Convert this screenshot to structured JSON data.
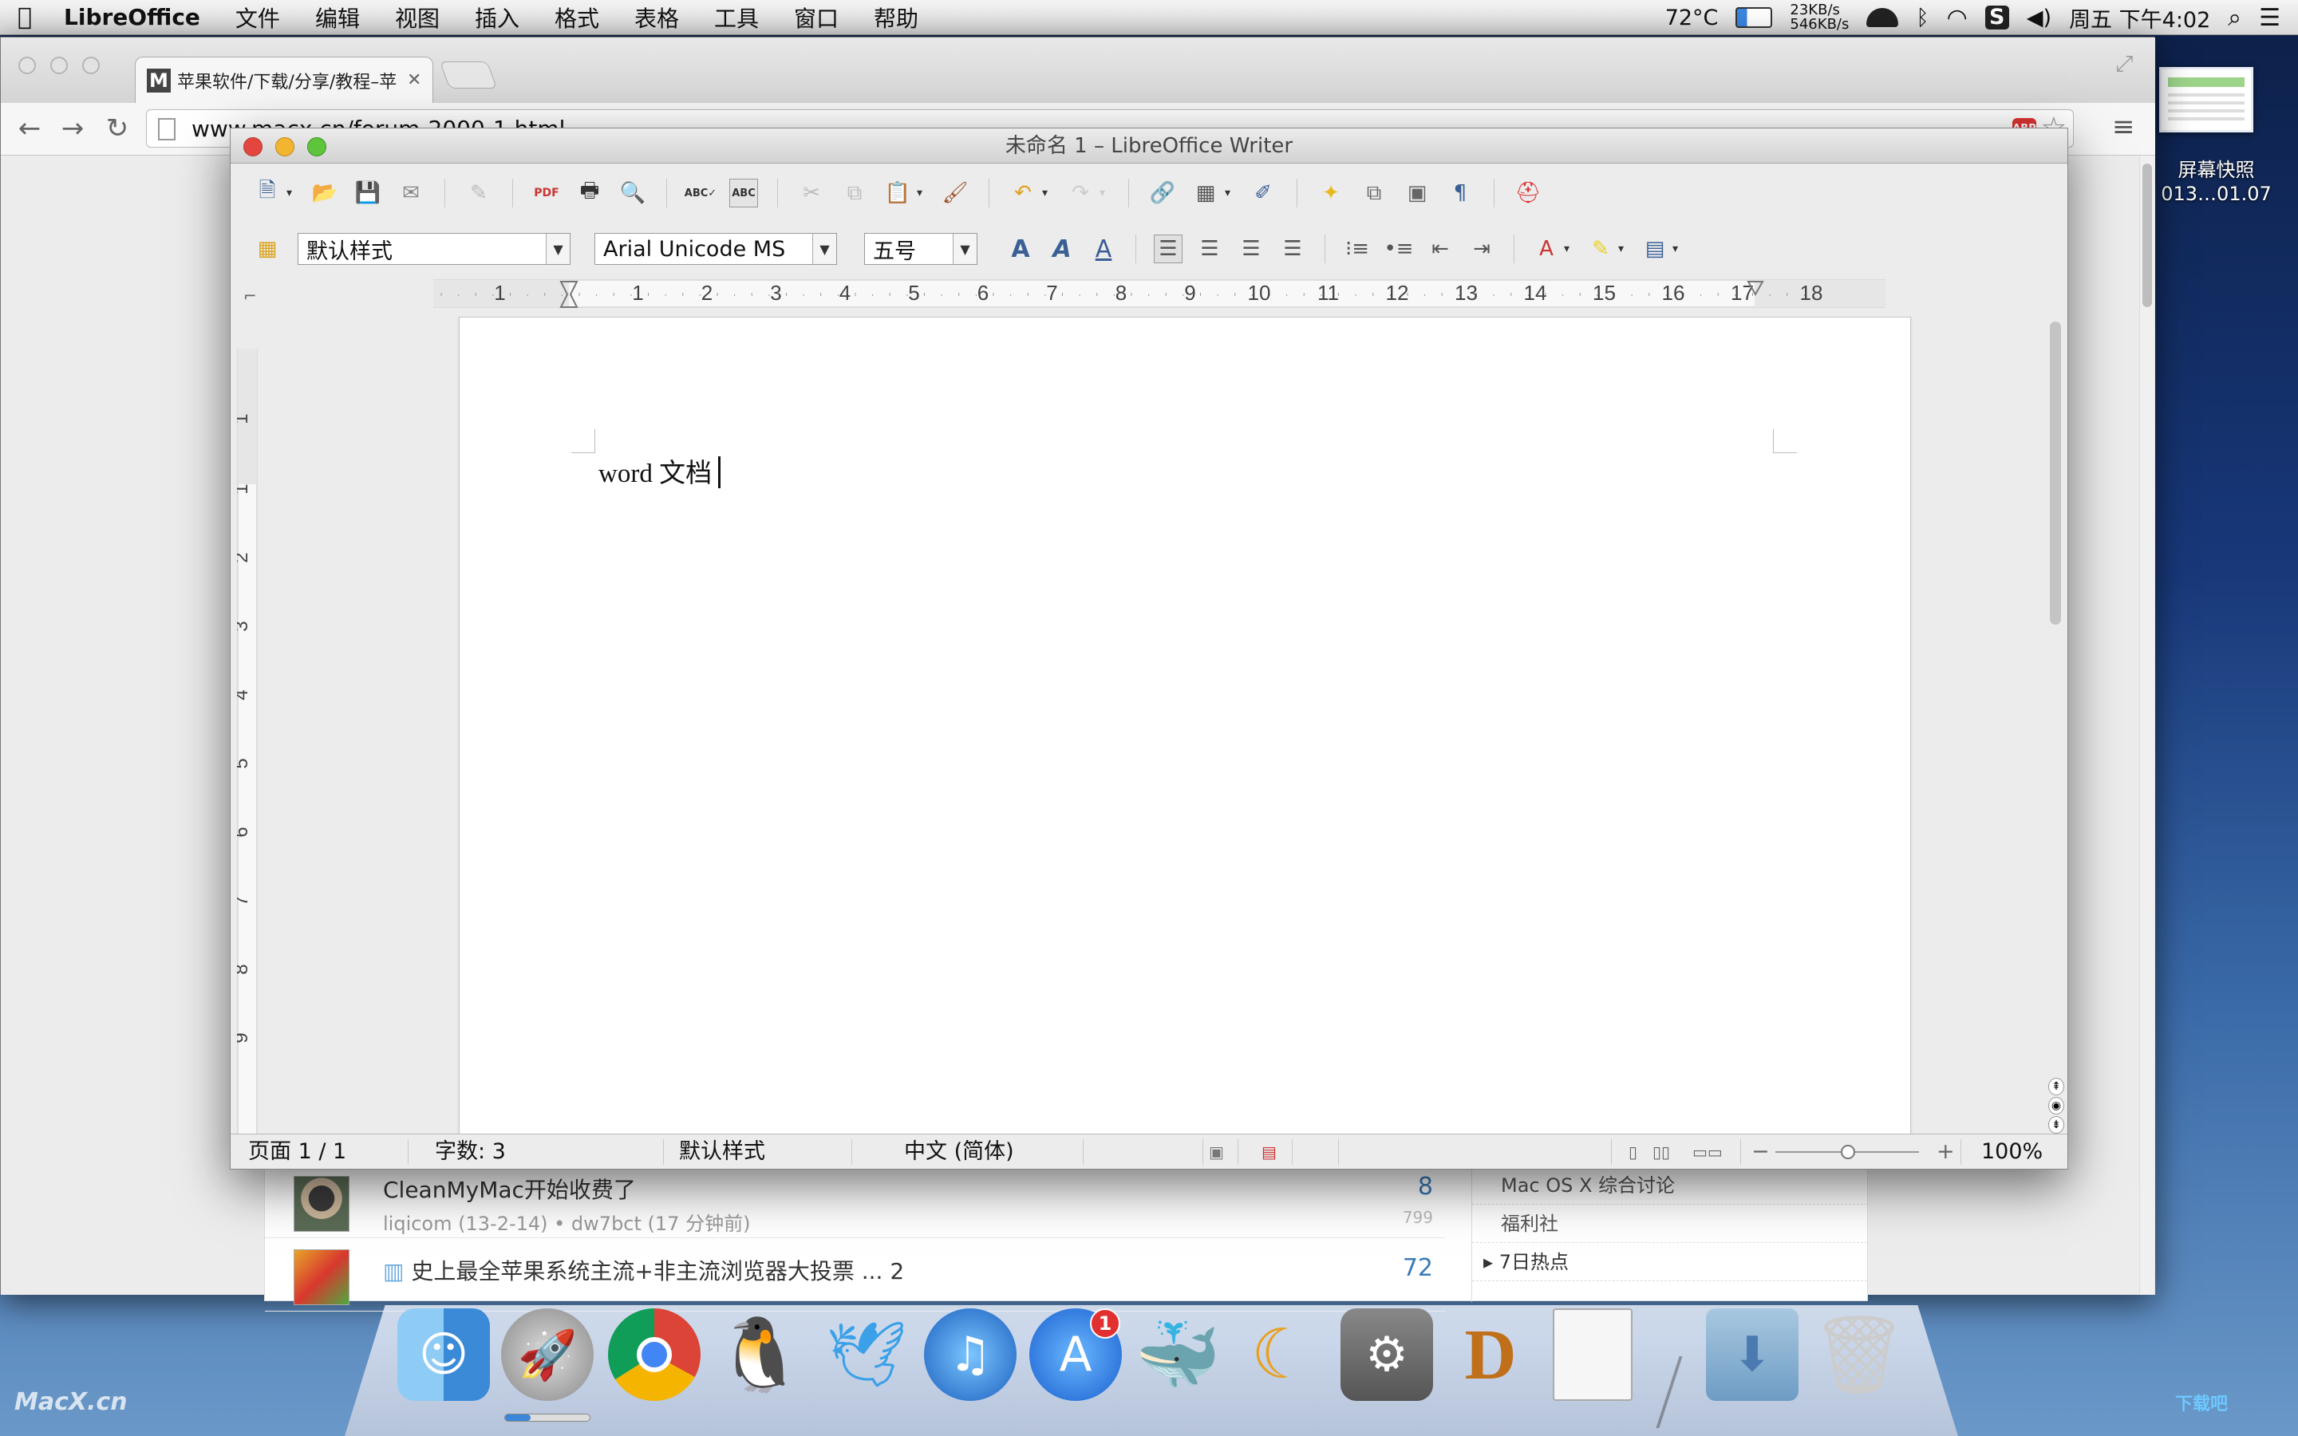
{
  "menubar": {
    "apple": "",
    "app_name": "LibreOffice",
    "items": [
      "文件",
      "编辑",
      "视图",
      "插入",
      "格式",
      "表格",
      "工具",
      "窗口",
      "帮助"
    ],
    "temp": "72°C",
    "net_up": "23KB/s",
    "net_down": "546KB/s",
    "clock": "周五 下午4:02"
  },
  "desktop": {
    "screenshot_label_line1": "屏幕快照",
    "screenshot_label_line2": "013…01.07"
  },
  "browser": {
    "tab_title": "苹果软件/下载/分享/教程–苹",
    "tab_favicon": "M",
    "url": "www.macx.cn/forum-2000-1.html",
    "abp": "ABP",
    "posts": [
      {
        "title": "CleanMyMac开始收费了",
        "meta": "liqicom (13-2-14) • dw7bct (17 分钟前)",
        "count": "8",
        "views": "799"
      },
      {
        "title": "史上最全苹果系统主流+非主流浏览器大投票 ... 2",
        "meta": "",
        "count": "72",
        "views": ""
      }
    ],
    "side_links": [
      "Mac OS X 综合讨论",
      "福利社",
      "7日热点"
    ]
  },
  "writer": {
    "title": "未命名 1 – LibreOffice Writer",
    "paragraph_style": "默认样式",
    "font_name": "Arial Unicode MS",
    "font_size": "五号",
    "ruler_numbers": [
      "1",
      "1",
      "2",
      "3",
      "4",
      "5",
      "6",
      "7",
      "8",
      "9",
      "10",
      "11",
      "12",
      "13",
      "14",
      "15",
      "16",
      "17",
      "18"
    ],
    "vruler_numbers": [
      "1",
      "1",
      "2",
      "3",
      "4",
      "5",
      "6",
      "7",
      "8",
      "9"
    ],
    "document_text": "word 文档",
    "status": {
      "page": "页面 1 / 1",
      "words": "字数: 3",
      "style": "默认样式",
      "language": "中文 (简体)",
      "zoom": "100%"
    }
  },
  "dock": {
    "apps": [
      "Finder",
      "Launchpad",
      "Google Chrome",
      "QQ",
      "Feiq",
      "iTunes",
      "App Store",
      "Weibo",
      "Coda",
      "System Preferences",
      "Diablo III",
      "LibreOffice",
      "Downloads",
      "Trash"
    ],
    "appstore_badge": "1",
    "launch_progress": 0.3
  },
  "watermarks": {
    "left": "MacX.cn",
    "right": "下载吧"
  },
  "colors": {
    "accent": "#3a7ab8",
    "close": "#e2463f",
    "minimize": "#f1b530",
    "zoom": "#5ec43b"
  }
}
